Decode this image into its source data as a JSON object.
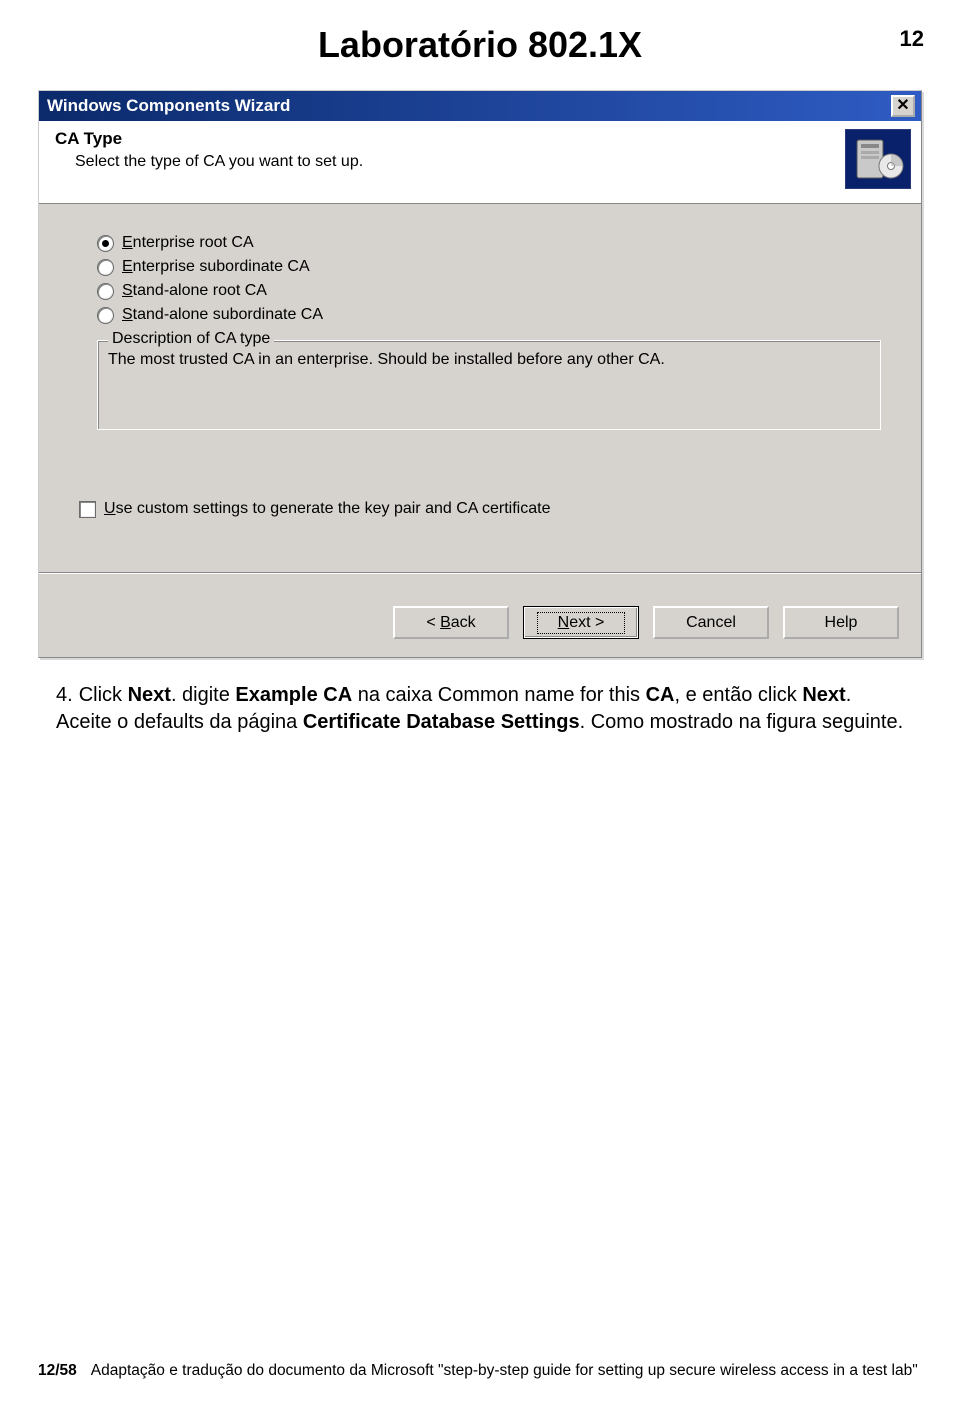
{
  "page": {
    "title": "Laboratório 802.1X",
    "number": "12"
  },
  "dialog": {
    "title": "Windows Components Wizard",
    "header_title": "CA Type",
    "header_sub": "Select the type of CA you want to set up.",
    "radios": [
      {
        "prefix": "E",
        "rest": "nterprise root CA",
        "selected": true
      },
      {
        "prefix": "E",
        "rest": "nterprise subordinate CA",
        "selected": false
      },
      {
        "prefix": "S",
        "rest": "tand-alone root CA",
        "selected": false
      },
      {
        "prefix": "S",
        "rest": "tand-alone subordinate CA",
        "selected": false
      }
    ],
    "fieldset_legend": "Description of CA type",
    "fieldset_desc": "The most trusted CA in an enterprise. Should be installed before any other CA.",
    "checkbox": {
      "prefix": "U",
      "rest": "se custom settings to generate the key pair and CA certificate"
    },
    "buttons": {
      "back": {
        "lt": "< ",
        "u": "B",
        "rest": "ack"
      },
      "next": {
        "u": "N",
        "rest": "ext >"
      },
      "cancel": "Cancel",
      "help": "Help"
    }
  },
  "instruction": {
    "num": "4.",
    "parts": {
      "p1": "Click ",
      "b1": "Next",
      "p2": ". digite ",
      "b2": "Example CA",
      "p3": " na caixa Common name for this ",
      "b3": "CA",
      "p4": ", e então click ",
      "b4": "Next",
      "p5": ". Aceite o defaults da página ",
      "b5": "Certificate Database Settings",
      "p6": ". Como mostrado na figura seguinte."
    }
  },
  "footer": {
    "page": "12/58",
    "text": "Adaptação e tradução do documento da Microsoft \"step-by-step guide for setting up secure wireless access in a test lab\""
  }
}
